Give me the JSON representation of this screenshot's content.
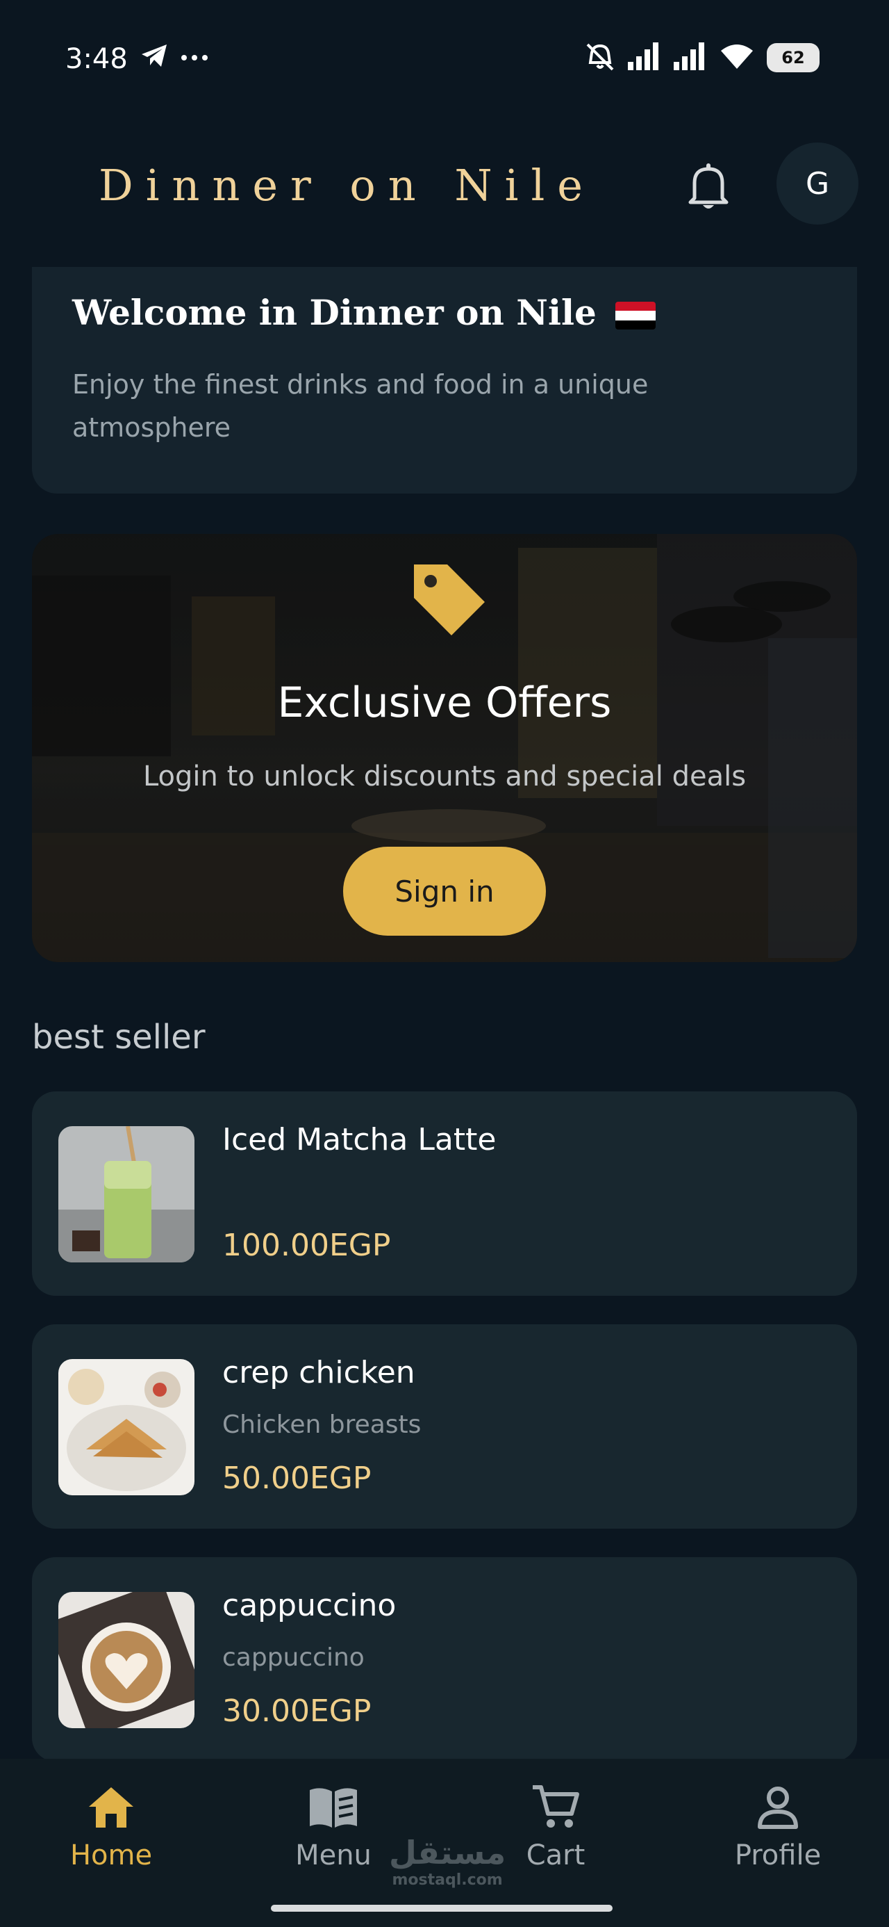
{
  "status_bar": {
    "time": "3:48",
    "battery": "62",
    "icons": [
      "telegram-icon",
      "more-icon",
      "mute-icon",
      "signal-icon",
      "signal-icon",
      "wifi-icon",
      "battery-icon"
    ]
  },
  "header": {
    "title": "Dinner on Nile",
    "bell_icon": "bell-icon",
    "avatar_letter": "G"
  },
  "welcome": {
    "title": "Welcome in Dinner on Nile",
    "subtitle": "Enjoy the finest drinks and food in a unique atmosphere"
  },
  "offers": {
    "icon": "tag-icon",
    "title": "Exclusive Offers",
    "subtitle": "Login to unlock discounts and special deals",
    "button_label": "Sign in"
  },
  "best_seller": {
    "section_title": "best seller",
    "items": [
      {
        "name": "Iced Matcha Latte",
        "description": "",
        "price": "100.00EGP"
      },
      {
        "name": "crep chicken",
        "description": "Chicken breasts",
        "price": "50.00EGP"
      },
      {
        "name": "cappuccino",
        "description": "cappuccino",
        "price": "30.00EGP"
      }
    ]
  },
  "bottom_nav": {
    "items": [
      {
        "label": "Home",
        "icon": "home-icon",
        "active": true
      },
      {
        "label": "Menu",
        "icon": "book-icon",
        "active": false
      },
      {
        "label": "Cart",
        "icon": "cart-icon",
        "active": false
      },
      {
        "label": "Profile",
        "icon": "person-icon",
        "active": false
      }
    ],
    "watermark_arabic": "مستقل",
    "watermark_latin": "mostaql.com"
  },
  "colors": {
    "background": "#0b1620",
    "card": "#18272f",
    "accent": "#e2b44a",
    "title": "#f0d29a"
  }
}
